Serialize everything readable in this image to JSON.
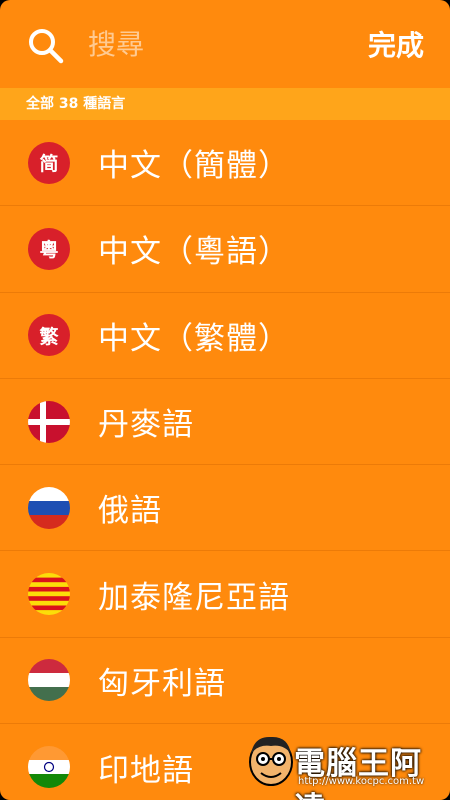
{
  "search": {
    "placeholder": "搜尋"
  },
  "header": {
    "done_label": "完成"
  },
  "section": {
    "title": "全部 38 種語言"
  },
  "languages": [
    {
      "label": "中文（簡體）",
      "flag_char": "简",
      "icon": "simplified-chinese-icon"
    },
    {
      "label": "中文（粵語）",
      "flag_char": "粵",
      "icon": "cantonese-icon"
    },
    {
      "label": "中文（繁體）",
      "flag_char": "繁",
      "icon": "traditional-chinese-icon"
    },
    {
      "label": "丹麥語",
      "icon": "denmark-flag-icon"
    },
    {
      "label": "俄語",
      "icon": "russia-flag-icon"
    },
    {
      "label": "加泰隆尼亞語",
      "icon": "catalonia-flag-icon"
    },
    {
      "label": "匈牙利語",
      "icon": "hungary-flag-icon"
    },
    {
      "label": "印地語",
      "icon": "india-flag-icon"
    }
  ],
  "watermark": {
    "title": "電腦王阿達",
    "url": "http://www.kocpc.com.tw"
  },
  "colors": {
    "background": "#FF8A0D",
    "section": "#FFA51A",
    "flag_red": "#D8202A"
  }
}
